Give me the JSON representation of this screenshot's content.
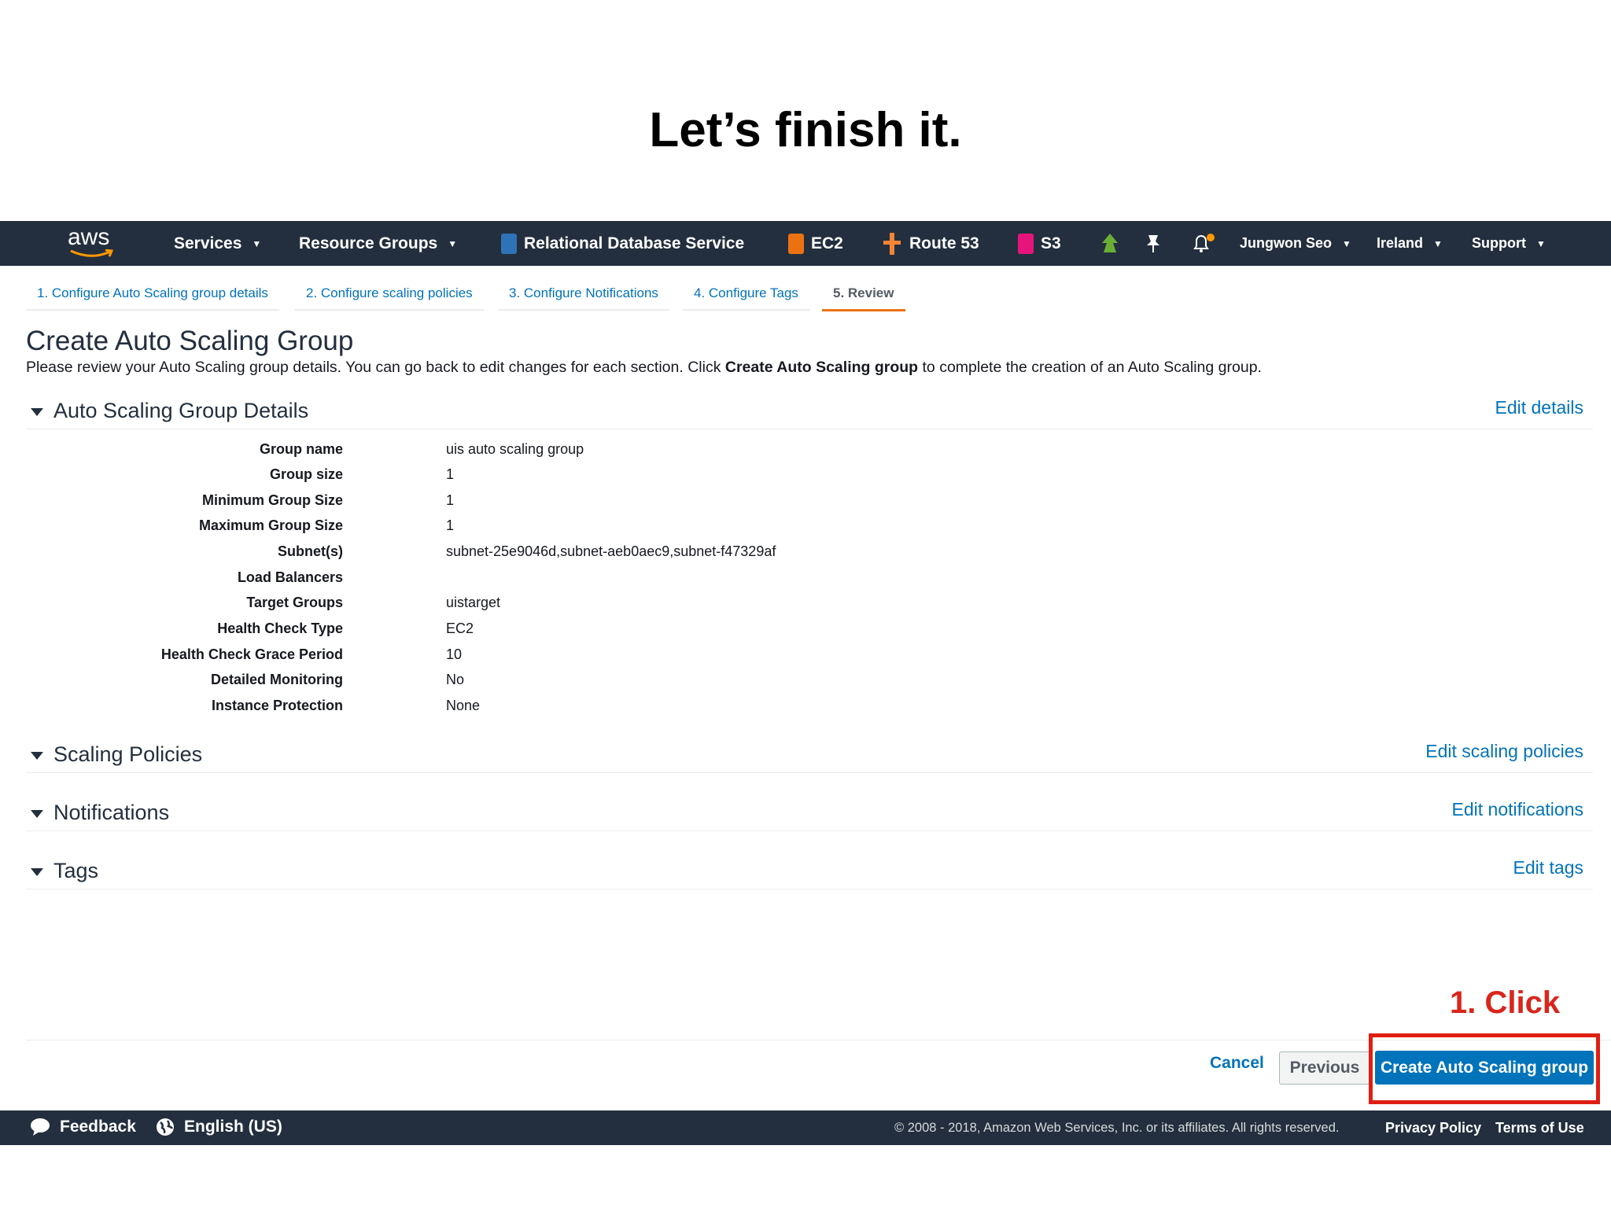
{
  "slide": {
    "title": "Let’s finish it."
  },
  "nav": {
    "logo": "aws",
    "services": "Services",
    "resource_groups": "Resource Groups",
    "rds": "Relational Database Service",
    "ec2": "EC2",
    "route53": "Route 53",
    "s3": "S3",
    "user": "Jungwon Seo",
    "region": "Ireland",
    "support": "Support",
    "colors": {
      "bar": "#232f3e",
      "rds_icon": "#2e73b8",
      "ec2_icon": "#ec7211",
      "route53_icon": "#f58536",
      "s3_icon": "#e7157b",
      "notif_dot": "#ff9900"
    }
  },
  "steps": [
    {
      "label": "1. Configure Auto Scaling group details"
    },
    {
      "label": "2. Configure scaling policies"
    },
    {
      "label": "3. Configure Notifications"
    },
    {
      "label": "4. Configure Tags"
    },
    {
      "label": "5. Review"
    }
  ],
  "page": {
    "title": "Create Auto Scaling Group",
    "desc_before": "Please review your Auto Scaling group details. You can go back to edit changes for each section. Click ",
    "desc_bold": "Create Auto Scaling group",
    "desc_after": " to complete the creation of an Auto Scaling group."
  },
  "sections": {
    "details": {
      "title": "Auto Scaling Group Details",
      "edit": "Edit details"
    },
    "policies": {
      "title": "Scaling Policies",
      "edit": "Edit scaling policies"
    },
    "notifications": {
      "title": "Notifications",
      "edit": "Edit notifications"
    },
    "tags": {
      "title": "Tags",
      "edit": "Edit tags"
    }
  },
  "details": [
    {
      "label": "Group name",
      "value": "uis auto scaling group"
    },
    {
      "label": "Group size",
      "value": "1"
    },
    {
      "label": "Minimum Group Size",
      "value": "1"
    },
    {
      "label": "Maximum Group Size",
      "value": "1"
    },
    {
      "label": "Subnet(s)",
      "value": "subnet-25e9046d,subnet-aeb0aec9,subnet-f47329af"
    },
    {
      "label": "Load Balancers",
      "value": ""
    },
    {
      "label": "Target Groups",
      "value": "uistarget"
    },
    {
      "label": "Health Check Type",
      "value": "EC2"
    },
    {
      "label": "Health Check Grace Period",
      "value": "10"
    },
    {
      "label": "Detailed Monitoring",
      "value": "No"
    },
    {
      "label": "Instance Protection",
      "value": "None"
    }
  ],
  "actions": {
    "annotation": "1. Click",
    "cancel": "Cancel",
    "previous": "Previous",
    "create": "Create Auto Scaling group"
  },
  "footer": {
    "feedback": "Feedback",
    "language": "English (US)",
    "copyright": "© 2008 - 2018, Amazon Web Services, Inc. or its affiliates. All rights reserved.",
    "privacy": "Privacy Policy",
    "terms": "Terms of Use"
  }
}
